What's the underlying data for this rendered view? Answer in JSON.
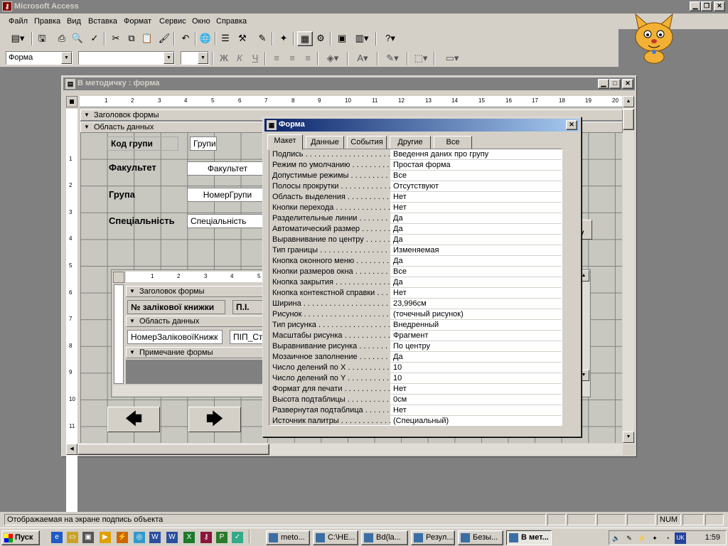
{
  "app": {
    "title": "Microsoft Access"
  },
  "menu": [
    "Файл",
    "Правка",
    "Вид",
    "Вставка",
    "Формат",
    "Сервис",
    "Окно",
    "Справка"
  ],
  "toolbar2": {
    "object_combo": "Форма",
    "bold": "Ж",
    "italic": "К",
    "underline": "Ч"
  },
  "form_window": {
    "title": "В методичку : форма",
    "header_section": "Заголовок формы",
    "detail_section": "Область данных",
    "ruler_h": [
      "1",
      "2",
      "3",
      "4",
      "5",
      "6",
      "7",
      "8",
      "9",
      "10",
      "11",
      "12",
      "13",
      "14",
      "15",
      "16",
      "17",
      "18",
      "19",
      "20"
    ],
    "ruler_v": [
      "1",
      "2",
      "3",
      "4",
      "5",
      "6",
      "7",
      "8",
      "9",
      "10",
      "11"
    ],
    "labels": {
      "code": "Код групи",
      "faculty": "Факультет",
      "group": "Група",
      "specialty": "Спеціальність"
    },
    "controls": {
      "code": "Групи",
      "faculty": "Факультет",
      "group": "НомерГрупи",
      "specialty": "Спеціальність"
    },
    "subform": {
      "header_section": "Заголовок формы",
      "detail_section": "Область данных",
      "footer_section": "Примечание формы",
      "header_label1": "№ залікової книжки",
      "header_label2": "П.І.",
      "field1": "НомерЗаліковоїКнижк",
      "field2": "ПІП_Ст",
      "ruler_h": [
        "1",
        "2",
        "3",
        "4",
        "5"
      ]
    },
    "nav_prev": "🡄",
    "nav_next": "🡆"
  },
  "properties": {
    "title": "Форма",
    "tabs": [
      "Макет",
      "Данные",
      "События",
      "Другие",
      "Все"
    ],
    "active_tab": "Макет",
    "rows": [
      {
        "name": "Подпись",
        "value": "Введення даних про групу"
      },
      {
        "name": "Режим по умолчанию",
        "value": "Простая форма"
      },
      {
        "name": "Допустимые режимы",
        "value": "Все"
      },
      {
        "name": "Полосы прокрутки",
        "value": "Отсутствуют"
      },
      {
        "name": "Область выделения",
        "value": "Нет"
      },
      {
        "name": "Кнопки перехода",
        "value": "Нет"
      },
      {
        "name": "Разделительные линии",
        "value": "Да"
      },
      {
        "name": "Автоматический размер",
        "value": "Да"
      },
      {
        "name": "Выравнивание по центру",
        "value": "Да"
      },
      {
        "name": "Тип границы",
        "value": "Изменяемая"
      },
      {
        "name": "Кнопка оконного меню",
        "value": "Да"
      },
      {
        "name": "Кнопки размеров окна",
        "value": "Все"
      },
      {
        "name": "Кнопка закрытия",
        "value": "Да"
      },
      {
        "name": "Кнопка контекстной справки",
        "value": "Нет"
      },
      {
        "name": "Ширина",
        "value": "23,996см"
      },
      {
        "name": "Рисунок",
        "value": "(точечный рисунок)"
      },
      {
        "name": "Тип рисунка",
        "value": "Внедренный"
      },
      {
        "name": "Масштабы рисунка",
        "value": "Фрагмент"
      },
      {
        "name": "Выравнивание рисунка",
        "value": "По центру"
      },
      {
        "name": "Мозаичное заполнение",
        "value": "Да"
      },
      {
        "name": "Число делений по X",
        "value": "10"
      },
      {
        "name": "Число делений по Y",
        "value": "10"
      },
      {
        "name": "Формат для печати",
        "value": "Нет"
      },
      {
        "name": "Высота подтаблицы",
        "value": "0см"
      },
      {
        "name": "Развернутая подтаблица",
        "value": "Нет"
      },
      {
        "name": "Источник палитры",
        "value": "(Специальный)"
      }
    ]
  },
  "status": {
    "text": "Отображаемая на экране подпись объекта",
    "num": "NUM"
  },
  "taskbar": {
    "start": "Пуск",
    "tasks": [
      {
        "label": "meto...",
        "active": false
      },
      {
        "label": "C:\\HE...",
        "active": false
      },
      {
        "label": "Bd(la...",
        "active": false
      },
      {
        "label": "Резул...",
        "active": false
      },
      {
        "label": "Безы...",
        "active": false
      },
      {
        "label": "В мет...",
        "active": true
      }
    ],
    "lang": "UK",
    "clock": "1:59"
  }
}
